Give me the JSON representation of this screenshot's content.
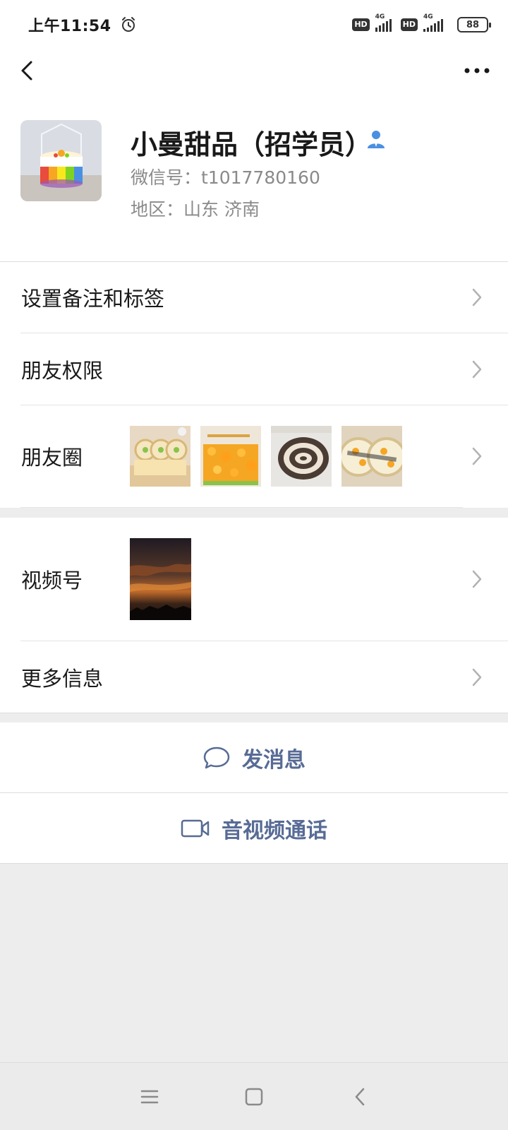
{
  "status_bar": {
    "time": "上午11:54",
    "hd_label": "HD",
    "network_label": "4G",
    "battery": "88"
  },
  "nav": {
    "back_icon": "chevron-left-icon",
    "more_icon": "more-horizontal-icon"
  },
  "profile": {
    "name": "小曼甜品（招学员）",
    "wechat_id": "微信号：t1017780160",
    "region": "地区：山东  济南",
    "badge_icon": "person-icon",
    "accent_color": "#4a90e2"
  },
  "menu": {
    "remark_label": "设置备注和标签",
    "permissions_label": "朋友权限",
    "moments_label": "朋友圈",
    "channels_label": "视频号",
    "more_info_label": "更多信息"
  },
  "actions": {
    "message_label": "发消息",
    "call_label": "音视频通话",
    "link_color": "#576b95"
  }
}
